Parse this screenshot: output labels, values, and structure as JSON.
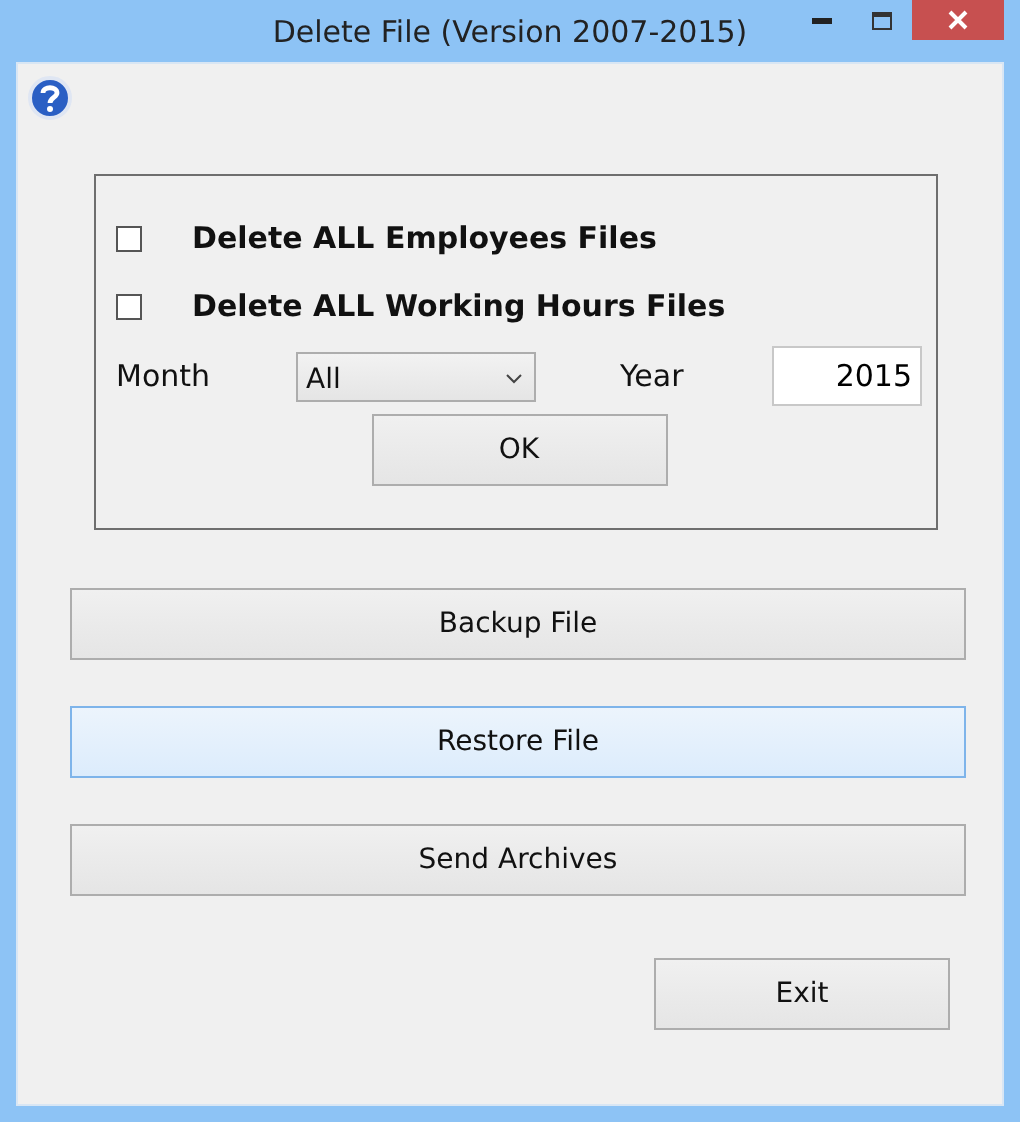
{
  "window": {
    "title": "Delete File (Version 2007-2015)"
  },
  "options": [
    {
      "label": "Delete ALL Employees Files",
      "checked": false
    },
    {
      "label": "Delete ALL Working Hours Files",
      "checked": false
    }
  ],
  "month": {
    "label": "Month",
    "value": "All"
  },
  "year": {
    "label": "Year",
    "value": "2015"
  },
  "ok_button": "OK",
  "buttons": [
    {
      "label": "Backup File",
      "highlighted": false
    },
    {
      "label": "Restore File",
      "highlighted": true
    },
    {
      "label": "Send Archives",
      "highlighted": false
    }
  ],
  "exit_button": "Exit"
}
